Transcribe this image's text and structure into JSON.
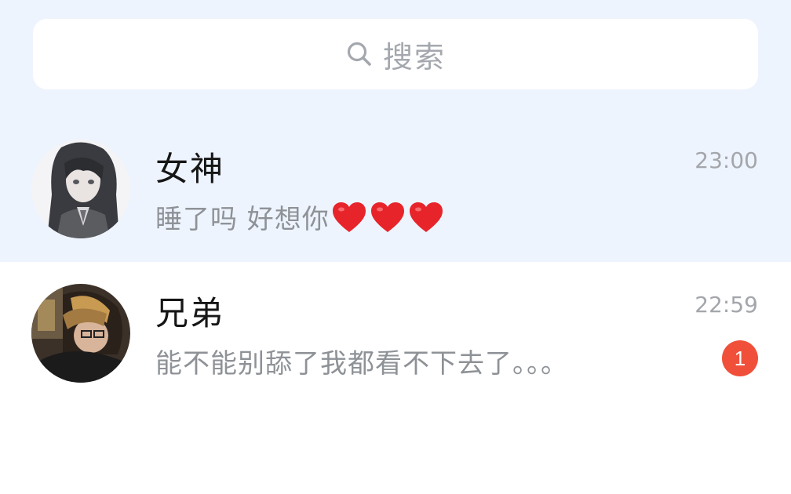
{
  "search": {
    "label": "搜索",
    "icon": "search-icon"
  },
  "chats": [
    {
      "name": "女神",
      "preview_text": "睡了吗 好想你",
      "preview_emoji": [
        "red-heart",
        "red-heart",
        "red-heart"
      ],
      "time": "23:00",
      "avatar": "anime-girl-avatar",
      "highlighted": true
    },
    {
      "name": "兄弟",
      "preview_text": "能不能别舔了我都看不下去了。。。",
      "time": "22:59",
      "unread_count": "1",
      "avatar": "photo-avatar",
      "highlighted": false
    }
  ],
  "colors": {
    "top_background": "#eef4fd",
    "badge": "#f0503a",
    "heart": "#e8242b"
  }
}
